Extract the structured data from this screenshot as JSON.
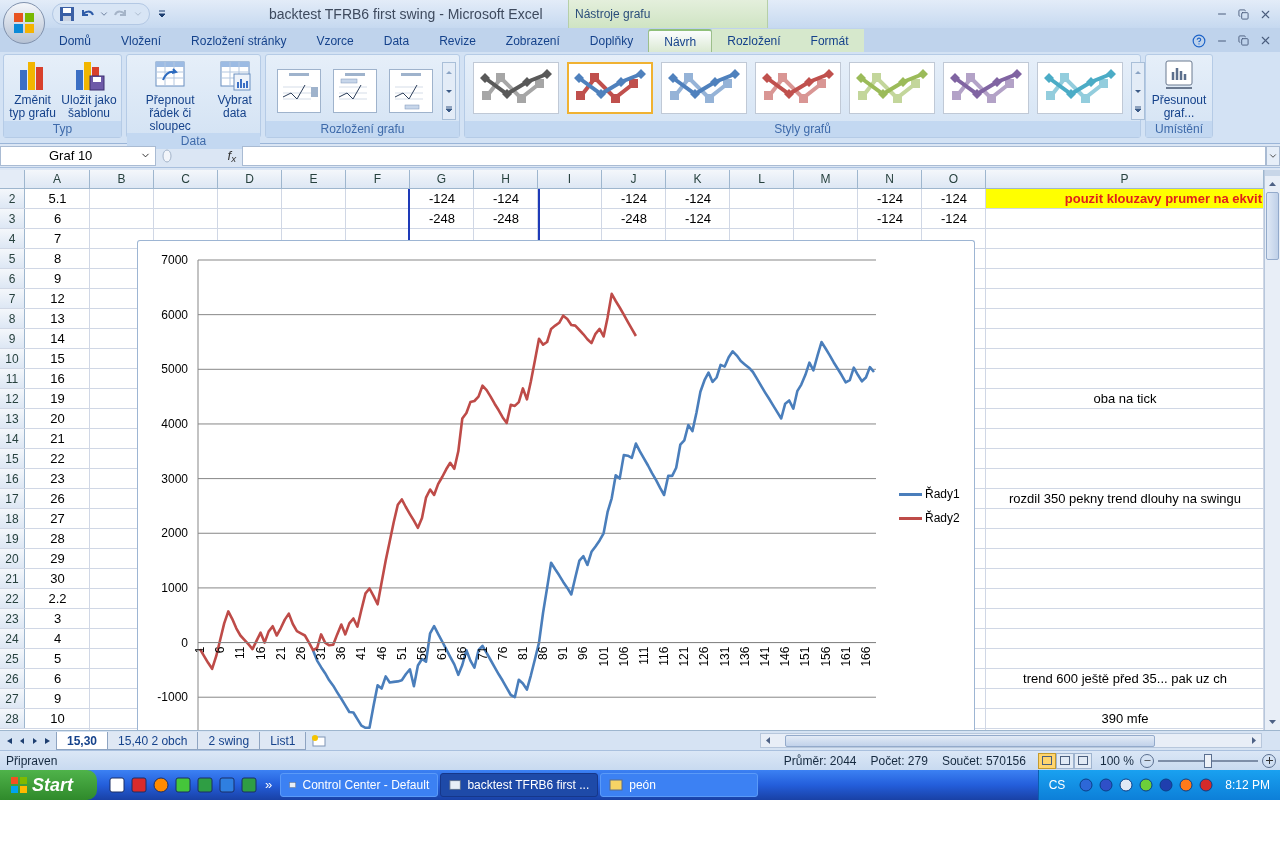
{
  "title_bar": {
    "title": "backtest TFRB6 first swing - Microsoft Excel",
    "context_label": "Nástroje grafu"
  },
  "tabs": [
    {
      "label": "Domů",
      "selected": false,
      "contextual": false
    },
    {
      "label": "Vložení",
      "selected": false,
      "contextual": false
    },
    {
      "label": "Rozložení stránky",
      "selected": false,
      "contextual": false
    },
    {
      "label": "Vzorce",
      "selected": false,
      "contextual": false
    },
    {
      "label": "Data",
      "selected": false,
      "contextual": false
    },
    {
      "label": "Revize",
      "selected": false,
      "contextual": false
    },
    {
      "label": "Zobrazení",
      "selected": false,
      "contextual": false
    },
    {
      "label": "Doplňky",
      "selected": false,
      "contextual": false
    },
    {
      "label": "Návrh",
      "selected": true,
      "contextual": true
    },
    {
      "label": "Rozložení",
      "selected": false,
      "contextual": true
    },
    {
      "label": "Formát",
      "selected": false,
      "contextual": true
    }
  ],
  "ribbon": {
    "type_group": {
      "label": "Typ",
      "buttons": [
        "Změnit typ grafu",
        "Uložit jako šablonu"
      ]
    },
    "data_group": {
      "label": "Data",
      "buttons": [
        "Přepnout řádek či sloupec",
        "Vybrat data"
      ]
    },
    "layout_group": {
      "label": "Rozložení grafu",
      "layouts": [
        {
          "selected": false
        },
        {
          "selected": false
        },
        {
          "selected": false
        }
      ]
    },
    "styles_group": {
      "label": "Styly grafů",
      "styles": [
        {
          "selected": false
        },
        {
          "selected": true
        },
        {
          "selected": false
        },
        {
          "selected": false
        },
        {
          "selected": false
        },
        {
          "selected": false
        },
        {
          "selected": false
        }
      ]
    },
    "location_group": {
      "label": "Umístění",
      "buttons": [
        "Přesunout graf..."
      ]
    }
  },
  "formula_bar": {
    "name_box": "Graf 10",
    "function_label": "f$_{x}$"
  },
  "sheet": {
    "columns": [
      "A",
      "B",
      "C",
      "D",
      "E",
      "F",
      "G",
      "H",
      "I",
      "J",
      "K",
      "L",
      "M",
      "N",
      "O",
      "P"
    ],
    "rows": [
      {
        "row": "2",
        "a": "5.1",
        "g": "-124",
        "h": "-124",
        "j": "-124",
        "k": "-124",
        "n": "-124",
        "o": "-124",
        "p": {
          "text": "pouzit klouzavy prumer na ekvit",
          "highlighted": true
        }
      },
      {
        "row": "3",
        "a": "6",
        "g": "-248",
        "h": "-248",
        "j": "-248",
        "k": "-124",
        "n": "-124",
        "o": "-124"
      },
      {
        "row": "4",
        "a": "7"
      },
      {
        "row": "5",
        "a": "8"
      },
      {
        "row": "6",
        "a": "9"
      },
      {
        "row": "7",
        "a": "12"
      },
      {
        "row": "8",
        "a": "13"
      },
      {
        "row": "9",
        "a": "14"
      },
      {
        "row": "10",
        "a": "15"
      },
      {
        "row": "11",
        "a": "16"
      },
      {
        "row": "12",
        "a": "19",
        "p": {
          "text": "oba na tick",
          "highlighted": false
        }
      },
      {
        "row": "13",
        "a": "20"
      },
      {
        "row": "14",
        "a": "21"
      },
      {
        "row": "15",
        "a": "22"
      },
      {
        "row": "16",
        "a": "23"
      },
      {
        "row": "17",
        "a": "26",
        "p": {
          "text": "rozdil 350 pekny trend dlouhy na swingu",
          "highlighted": false
        }
      },
      {
        "row": "18",
        "a": "27"
      },
      {
        "row": "19",
        "a": "28"
      },
      {
        "row": "20",
        "a": "29"
      },
      {
        "row": "21",
        "a": "30"
      },
      {
        "row": "22",
        "a": "2.2"
      },
      {
        "row": "23",
        "a": "3"
      },
      {
        "row": "24",
        "a": "4"
      },
      {
        "row": "25",
        "a": "5"
      },
      {
        "row": "26",
        "a": "6",
        "p": {
          "text": "trend 600 ještě před 35... pak uz ch",
          "highlighted": false
        }
      },
      {
        "row": "27",
        "a": "9"
      },
      {
        "row": "28",
        "a": "10",
        "p": {
          "text": "390 mfe",
          "highlighted": false
        }
      }
    ]
  },
  "chart": {
    "chart_data": {
      "type": "line",
      "x": [
        1,
        2,
        3,
        4,
        5,
        6,
        7,
        8,
        9,
        10,
        11,
        12,
        13,
        14,
        15,
        16,
        17,
        18,
        19,
        20,
        21,
        22,
        23,
        24,
        25,
        26,
        27,
        28,
        29,
        30,
        31,
        32,
        33,
        34,
        35,
        36,
        37,
        38,
        39,
        40,
        41,
        42,
        43,
        44,
        45,
        46,
        47,
        48,
        49,
        50,
        51,
        52,
        53,
        54,
        55,
        56,
        57,
        58,
        59,
        60,
        61,
        62,
        63,
        64,
        65,
        66,
        67,
        68,
        69,
        70,
        71,
        72,
        73,
        74,
        75,
        76,
        77,
        78,
        79,
        80,
        81,
        82,
        83,
        84,
        85,
        86,
        87,
        88,
        89,
        90,
        91,
        92,
        93,
        94,
        95,
        96,
        97,
        98,
        99,
        100,
        101,
        102,
        103,
        104,
        105,
        106,
        107,
        108,
        109,
        110,
        111,
        112,
        113,
        114,
        115,
        116,
        117,
        118,
        119,
        120,
        121,
        122,
        123,
        124,
        125,
        126,
        127,
        128,
        129,
        130,
        131,
        132,
        133,
        134,
        135,
        136,
        137,
        138,
        139,
        140,
        141,
        142,
        143,
        144,
        145,
        146,
        147,
        148,
        149,
        150,
        151,
        152,
        153,
        154,
        155,
        156,
        157,
        158,
        159,
        160,
        161,
        162,
        163,
        164,
        165,
        166,
        167,
        168
      ],
      "series": [
        {
          "name": "Řady1",
          "color": "#4a7ebb",
          "values": [
            null,
            null,
            null,
            null,
            null,
            null,
            null,
            null,
            null,
            null,
            null,
            null,
            null,
            null,
            null,
            null,
            null,
            null,
            null,
            null,
            null,
            null,
            null,
            null,
            null,
            null,
            null,
            null,
            -140,
            -330,
            -450,
            -560,
            -690,
            -790,
            -910,
            -1030,
            -1150,
            -1270,
            -1280,
            -1400,
            -1520,
            -1560,
            -1560,
            -1150,
            -780,
            -840,
            -620,
            -730,
            -720,
            -710,
            -690,
            -580,
            -490,
            -800,
            -420,
            -300,
            -350,
            170,
            300,
            160,
            20,
            -120,
            -260,
            -400,
            -590,
            -410,
            -140,
            -330,
            -460,
            -140,
            -60,
            -190,
            -320,
            -450,
            -580,
            -700,
            -830,
            -960,
            -1000,
            -680,
            -750,
            -860,
            -600,
            -300,
            0,
            550,
            1000,
            1460,
            1340,
            1230,
            1110,
            1000,
            880,
            1190,
            1500,
            1580,
            1420,
            1660,
            1760,
            1870,
            2000,
            2390,
            2640,
            3060,
            3000,
            3430,
            3420,
            3380,
            3640,
            3500,
            3370,
            3240,
            3100,
            2970,
            2830,
            2700,
            3050,
            3050,
            3200,
            3620,
            3700,
            3980,
            3870,
            4200,
            4590,
            4800,
            4940,
            4770,
            4850,
            5080,
            5050,
            5220,
            5330,
            5250,
            5150,
            5090,
            5030,
            4950,
            4830,
            4700,
            4580,
            4460,
            4340,
            4220,
            4100,
            4370,
            4430,
            4280,
            4600,
            4720,
            4900,
            5120,
            4980,
            5250,
            5500,
            5380,
            5260,
            5130,
            5010,
            4890,
            4760,
            4800,
            5030,
            4900,
            4780,
            4850,
            5040,
            4950
          ]
        },
        {
          "name": "Řady2",
          "color": "#be4b48",
          "values": [
            -120,
            -250,
            -370,
            -480,
            -250,
            50,
            350,
            570,
            430,
            260,
            130,
            50,
            -30,
            -120,
            30,
            180,
            0,
            200,
            300,
            130,
            260,
            420,
            530,
            340,
            210,
            170,
            130,
            0,
            -140,
            -100,
            150,
            0,
            -50,
            -40,
            150,
            330,
            150,
            350,
            440,
            290,
            600,
            900,
            990,
            850,
            700,
            1100,
            1500,
            1850,
            2200,
            2520,
            2620,
            2480,
            2350,
            2230,
            2100,
            2280,
            2650,
            2800,
            2700,
            2900,
            3030,
            3170,
            3290,
            3180,
            3500,
            4100,
            4200,
            4400,
            4420,
            4500,
            4700,
            4620,
            4500,
            4370,
            4250,
            4120,
            4020,
            4350,
            4330,
            4400,
            4650,
            4450,
            4780,
            5170,
            5560,
            5450,
            5500,
            5740,
            5800,
            5850,
            5980,
            5920,
            5810,
            5800,
            5720,
            5640,
            5550,
            5480,
            5650,
            5740,
            5600,
            5950,
            6380,
            6250,
            6130,
            6000,
            5870,
            5740,
            5610,
            null,
            null,
            null,
            null,
            null,
            null,
            null,
            null,
            null,
            null,
            null,
            null,
            null,
            null,
            null,
            null,
            null,
            null,
            null,
            null,
            null,
            null,
            null,
            null,
            null,
            null,
            null,
            null,
            null,
            null,
            null,
            null,
            null,
            null,
            null,
            null,
            null,
            null,
            null,
            null,
            null,
            null,
            null,
            null,
            null,
            null,
            null,
            null,
            null,
            null,
            null,
            null,
            null,
            null,
            null,
            null,
            null,
            null,
            null
          ]
        }
      ],
      "xlim": [
        0.5,
        168.5
      ],
      "ylim": [
        -1600,
        7000
      ],
      "grid": true,
      "legend": true,
      "yticks": [
        -1000,
        0,
        1000,
        2000,
        3000,
        4000,
        5000,
        6000,
        7000
      ],
      "xticks": [
        1,
        6,
        11,
        16,
        21,
        26,
        31,
        36,
        41,
        46,
        51,
        56,
        61,
        66,
        71,
        76,
        81,
        86,
        91,
        96,
        101,
        106,
        111,
        116,
        121,
        126,
        131,
        136,
        141,
        146,
        151,
        156,
        161,
        166
      ]
    }
  },
  "sheet_tabs": [
    {
      "label": "15,30",
      "selected": true
    },
    {
      "label": "15,40 2 obch",
      "selected": false
    },
    {
      "label": "2 swing",
      "selected": false
    },
    {
      "label": "List1",
      "selected": false
    }
  ],
  "status_bar": {
    "mode": "Připraven",
    "average": "Průměr: 2044",
    "count": "Počet: 279",
    "sum": "Součet: 570156",
    "views": [
      {
        "selected": true
      },
      {
        "selected": false
      },
      {
        "selected": false
      }
    ],
    "zoom": "100 %",
    "zoom_slider": {
      "level": 0.5
    }
  },
  "taskbar": {
    "start": "Start",
    "overflow": "»",
    "tasks": [
      {
        "label": "Control Center - Default",
        "selected": false
      },
      {
        "label": "backtest TFRB6 first ...",
        "selected": true
      },
      {
        "label": "peón",
        "selected": false
      }
    ],
    "language": "CS",
    "clock": "8:12 PM"
  }
}
